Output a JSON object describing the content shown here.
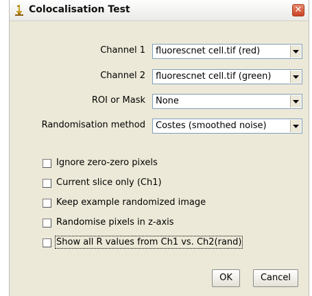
{
  "window": {
    "title": "Colocalisation Test",
    "close_label": "✕"
  },
  "fields": [
    {
      "label": "Channel 1",
      "value": "fluorescnet cell.tif (red)"
    },
    {
      "label": "Channel 2",
      "value": "fluorescnet cell.tif (green)"
    },
    {
      "label": "ROI or Mask",
      "value": "None"
    },
    {
      "label": "Randomisation method",
      "value": "Costes (smoothed noise)"
    }
  ],
  "options": [
    {
      "label": "Ignore zero-zero pixels",
      "checked": false
    },
    {
      "label": "Current slice only (Ch1)",
      "checked": false
    },
    {
      "label": "Keep example randomized image",
      "checked": false
    },
    {
      "label": "Randomise pixels in z-axis",
      "checked": false
    },
    {
      "label": "Show all R values from Ch1 vs. Ch2(rand)",
      "checked": false
    }
  ],
  "buttons": {
    "ok": "OK",
    "cancel": "Cancel"
  },
  "colors": {
    "dialog_bg": "#ece9d8",
    "close_button": "#c94326"
  }
}
